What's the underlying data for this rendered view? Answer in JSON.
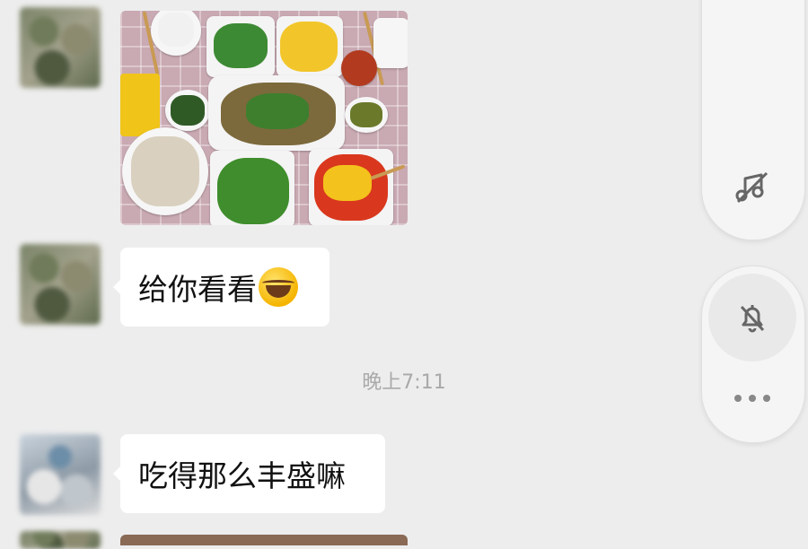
{
  "messages": [
    {
      "type": "image",
      "sender": "contact-1",
      "description": "food-photo"
    },
    {
      "type": "text",
      "sender": "contact-1",
      "text": "给你看看",
      "emoji": "laughing-tears-emoji"
    },
    {
      "type": "timestamp",
      "text": "晚上7:11"
    },
    {
      "type": "text",
      "sender": "contact-2",
      "text": "吃得那么丰盛嘛"
    }
  ],
  "side_panel": {
    "music_icon": "music-note-slash-icon",
    "mute_icon": "bell-slash-icon",
    "more_icon": "more-dots-icon"
  },
  "colors": {
    "background": "#ededed",
    "bubble": "#ffffff",
    "timestamp": "#a9a9a9"
  }
}
